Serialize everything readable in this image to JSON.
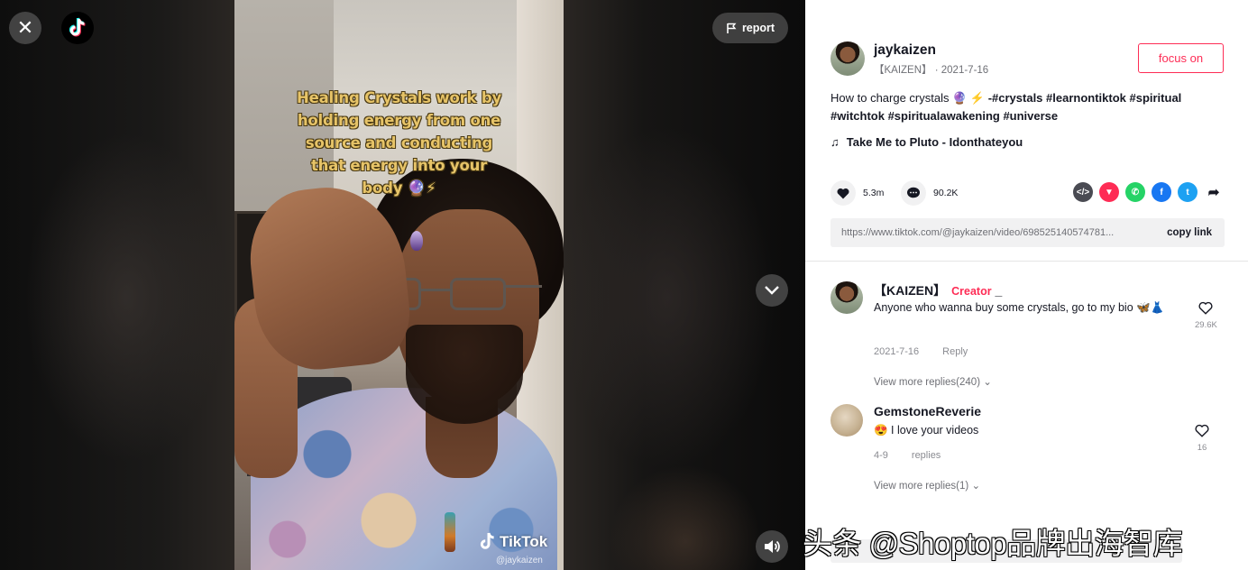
{
  "player": {
    "overlay_lines": [
      "Healing Crystals work by",
      "holding energy from one",
      "source and conducting",
      "that energy into your",
      "body 🔮⚡"
    ],
    "watermark_brand": "TikTok",
    "watermark_handle": "@jaykaizen",
    "report_label": "report",
    "close_icon": "close-icon",
    "next_icon": "chevron-down-icon",
    "volume_icon": "volume-icon"
  },
  "post": {
    "author": "jaykaizen",
    "author_sub": "【KAIZEN】 · 2021-7-16",
    "follow_label": "focus on",
    "caption": "How to charge crystals 🔮 ⚡ ",
    "hashtags": "-#crystals #learnontiktok #spiritual #witchtok #spiritualawakening #universe",
    "music": "Take Me to Pluto - Idonthateyou",
    "likes": "5.3m",
    "comments_count": "90.2K",
    "share_link": "https://www.tiktok.com/@jaykaizen/video/698525140574781...",
    "copy_label": "copy link"
  },
  "share_targets": [
    {
      "name": "embed-icon",
      "glyph": "</>",
      "color": "#4a4b53"
    },
    {
      "name": "send-icon",
      "glyph": "▼",
      "color": "#fe2c55"
    },
    {
      "name": "whatsapp-icon",
      "glyph": "✆",
      "color": "#25d366"
    },
    {
      "name": "facebook-icon",
      "glyph": "f",
      "color": "#1877f2"
    },
    {
      "name": "twitter-icon",
      "glyph": "t",
      "color": "#1da1f2"
    }
  ],
  "comments": [
    {
      "author": "【KAIZEN】",
      "badge": "Creator",
      "badge_suffix": "_",
      "text": "Anyone who wanna buy some crystals, go to my bio 🦋👗",
      "date": "2021-7-16",
      "reply_label": "Reply",
      "likes": "29.6K",
      "more": "View more replies(240)"
    },
    {
      "author": "GemstoneReverie",
      "text": "😍 I love your videos",
      "date": "4-9",
      "reply_label": "replies",
      "likes": "16",
      "more": "View more replies(1)"
    }
  ],
  "overlay_watermark": "头条 @Shoptop品牌出海智库",
  "colors": {
    "accent": "#fe2c55",
    "text": "#161823",
    "muted": "#8a8b91",
    "overlay_text": "#e7c468"
  }
}
